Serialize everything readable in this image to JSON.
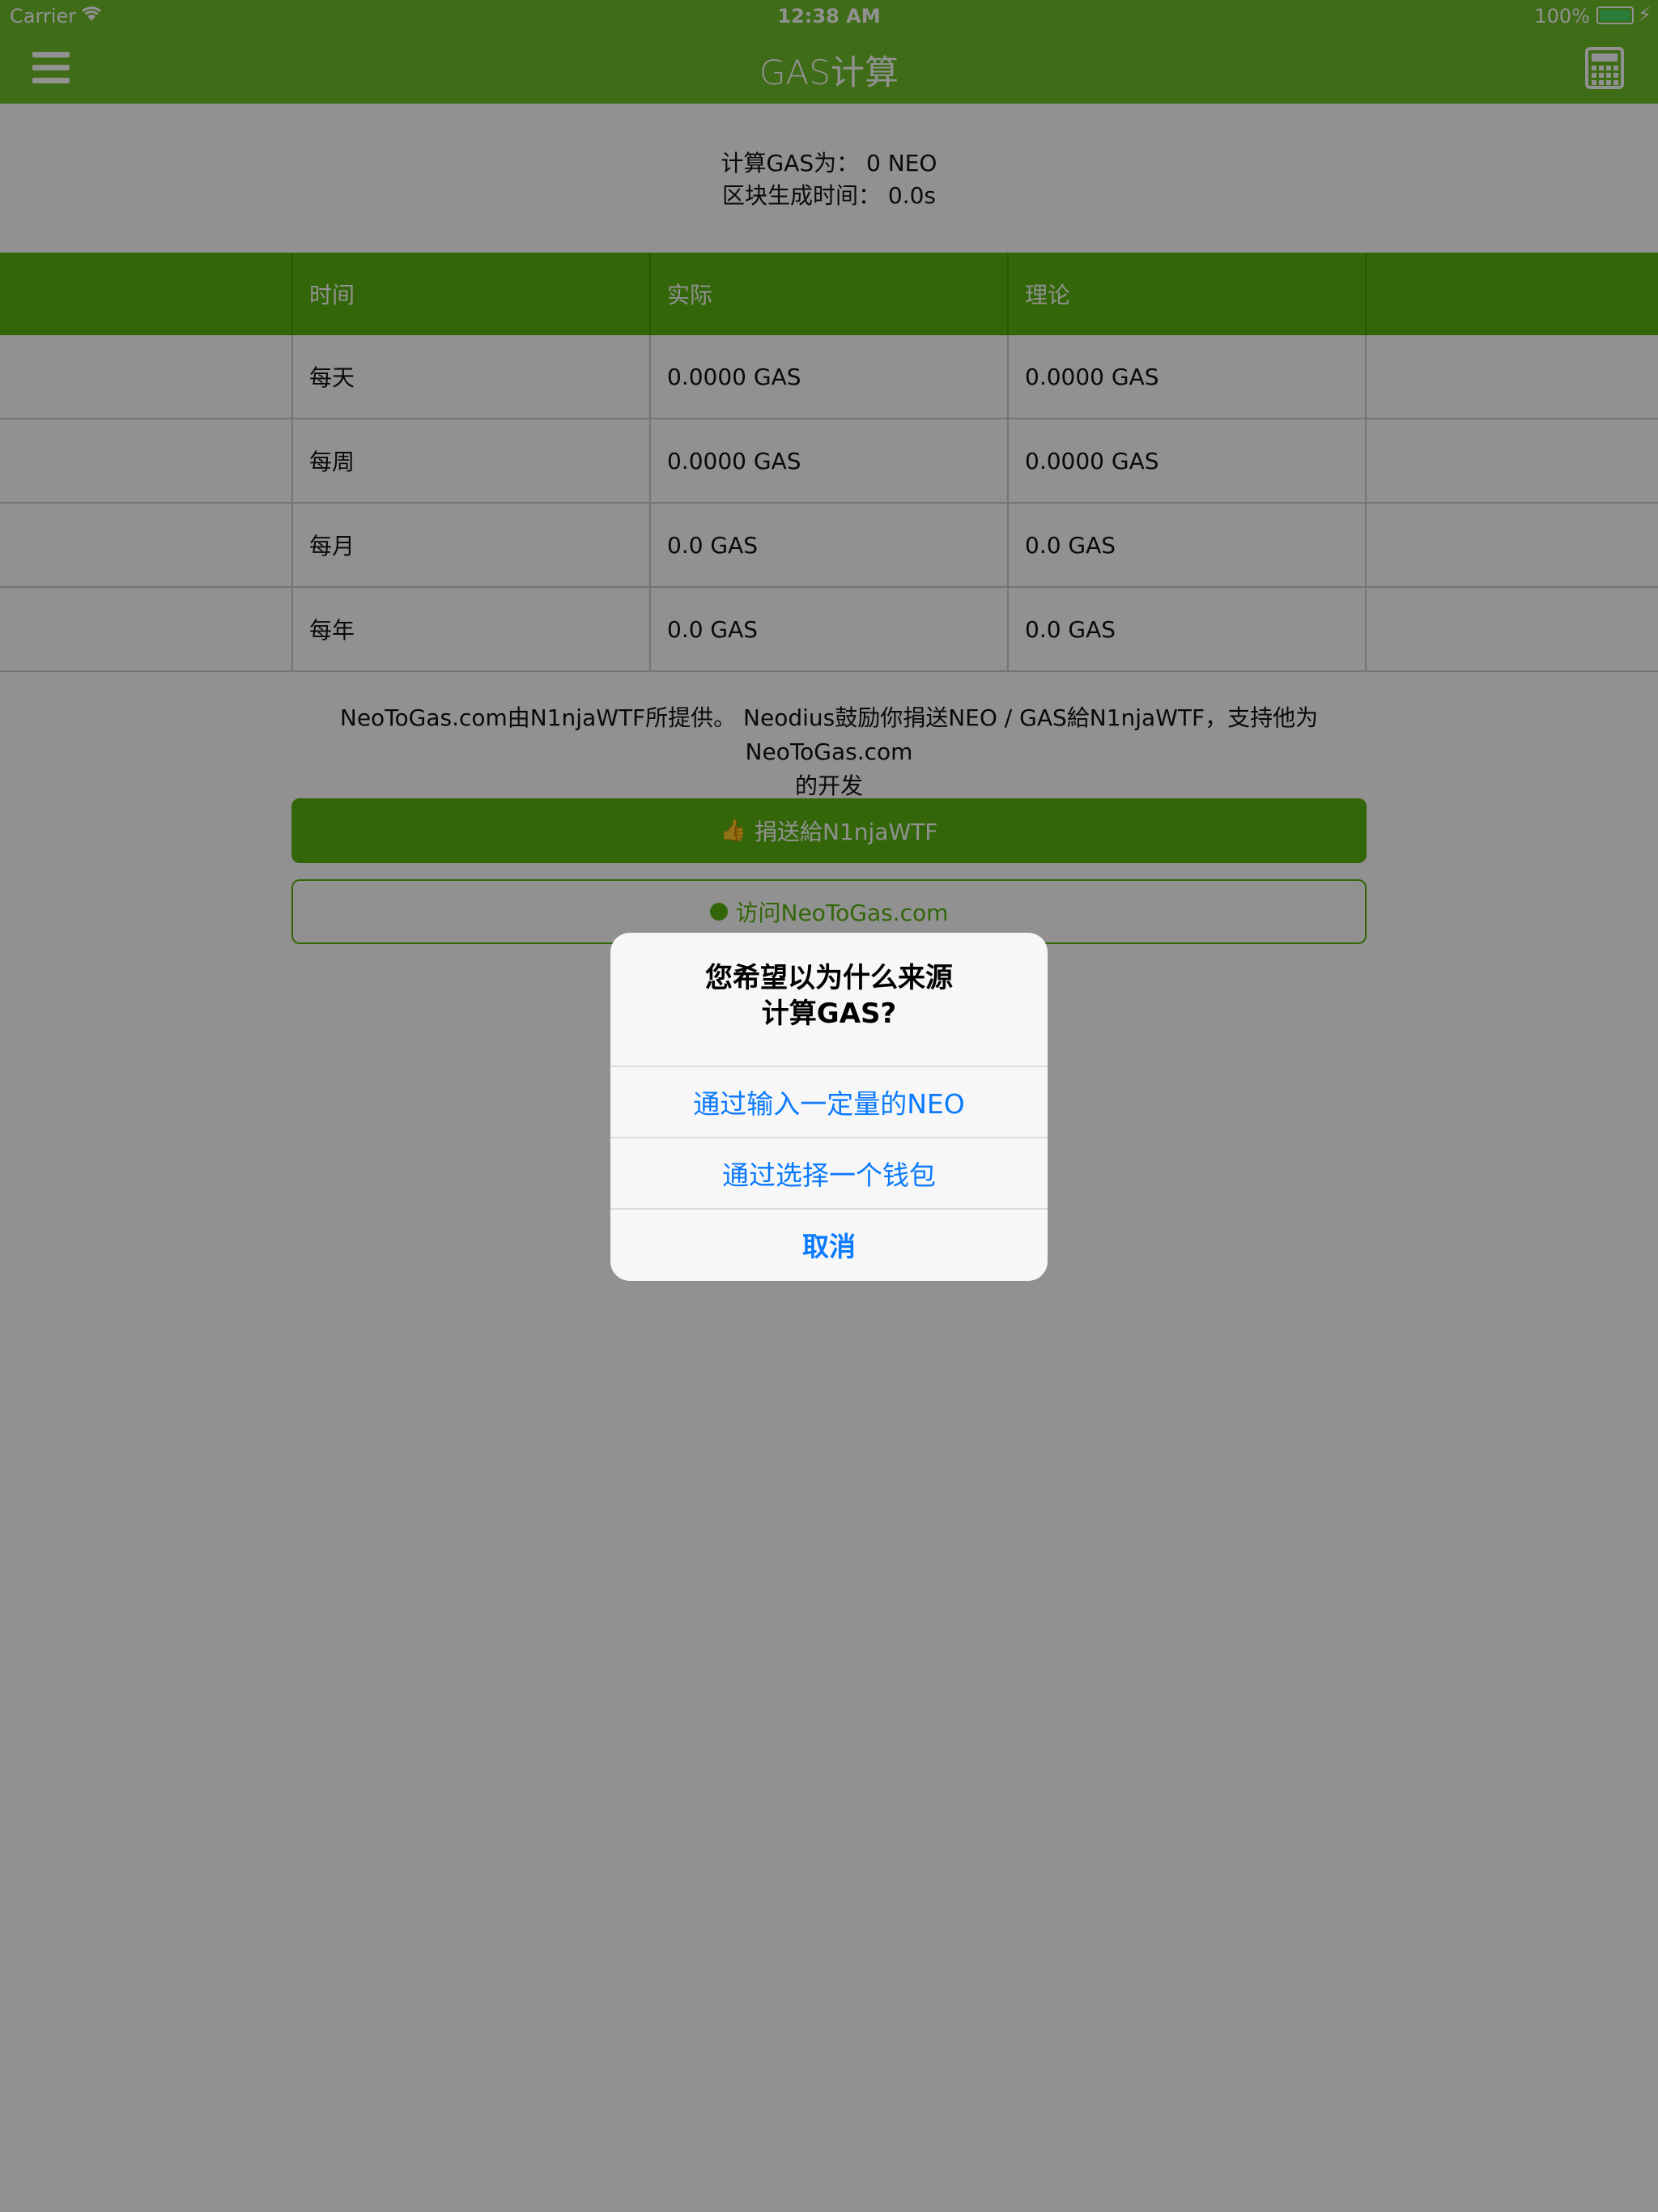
{
  "status_bar": {
    "carrier": "Carrier",
    "time": "12:38 AM",
    "battery": "100%"
  },
  "nav": {
    "title": "GAS计算",
    "menu_icon": "hamburger-menu-icon",
    "calc_icon": "calculator-icon"
  },
  "summary": {
    "line1": "计算GAS为：  0 NEO",
    "line2": "区块生成时间：  0.0s"
  },
  "table": {
    "headers": [
      "时间",
      "实际",
      "理论"
    ],
    "rows": [
      [
        "每天",
        "0.0000 GAS",
        "0.0000 GAS"
      ],
      [
        "每周",
        "0.0000 GAS",
        "0.0000 GAS"
      ],
      [
        "每月",
        "0.0 GAS",
        "0.0 GAS"
      ],
      [
        "每年",
        "0.0 GAS",
        "0.0 GAS"
      ]
    ]
  },
  "credit": {
    "line1": "NeoToGas.com由N1njaWTF所提供。 Neodius鼓励你捐送NEO / GAS給N1njaWTF，支持他为NeoToGas.com",
    "line2": "的开发"
  },
  "buttons": {
    "donate": "捐送給N1njaWTF",
    "visit": "访问NeoToGas.com"
  },
  "alert": {
    "title_line1": "您希望以为什么来源",
    "title_line2": "计算GAS?",
    "option_neo": "通过输入一定量的NEO",
    "option_wallet": "通过选择一个钱包",
    "cancel": "取消"
  },
  "colors": {
    "brand_green": "#6fbf29",
    "table_header": "#5ab30f",
    "ios_blue": "#0a7aff"
  }
}
